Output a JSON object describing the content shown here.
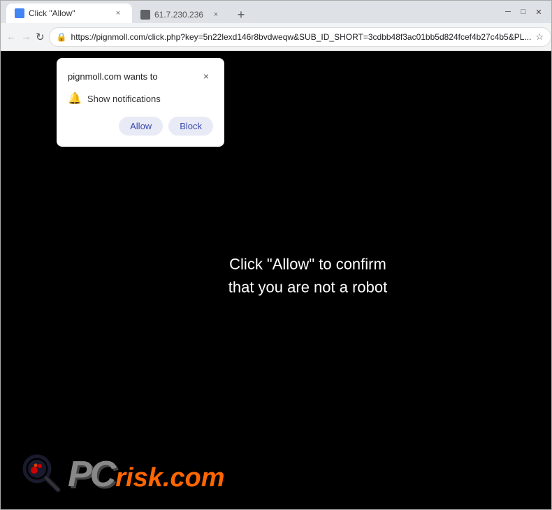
{
  "browser": {
    "tabs": [
      {
        "id": "tab1",
        "label": "Click \"Allow\"",
        "active": true,
        "favicon": "page-icon"
      },
      {
        "id": "tab2",
        "label": "61.7.230.236",
        "active": false,
        "favicon": "page-icon"
      }
    ],
    "address_bar": {
      "url": "https://pignmoll.com/click.php?key=5n22lexd146r8bvdweqw&SUB_ID_SHORT=3cdbb48f3ac01bb5d824fcef4b27c4b5&PL...",
      "lock_icon": "lock",
      "star_icon": "star"
    },
    "nav": {
      "back_label": "←",
      "forward_label": "→",
      "refresh_label": "↻"
    }
  },
  "notification_popup": {
    "title": "pignmoll.com wants to",
    "close_label": "×",
    "bell_icon": "🔔",
    "notification_label": "Show notifications",
    "allow_label": "Allow",
    "block_label": "Block"
  },
  "page": {
    "background": "#000000",
    "main_text_line1": "Click \"Allow\" to confirm",
    "main_text_line2": "that you are not a robot"
  },
  "logo": {
    "pc_letters": "PC",
    "risk_text": "risk.com"
  },
  "window_controls": {
    "minimize": "─",
    "maximize": "□",
    "close": "✕"
  }
}
